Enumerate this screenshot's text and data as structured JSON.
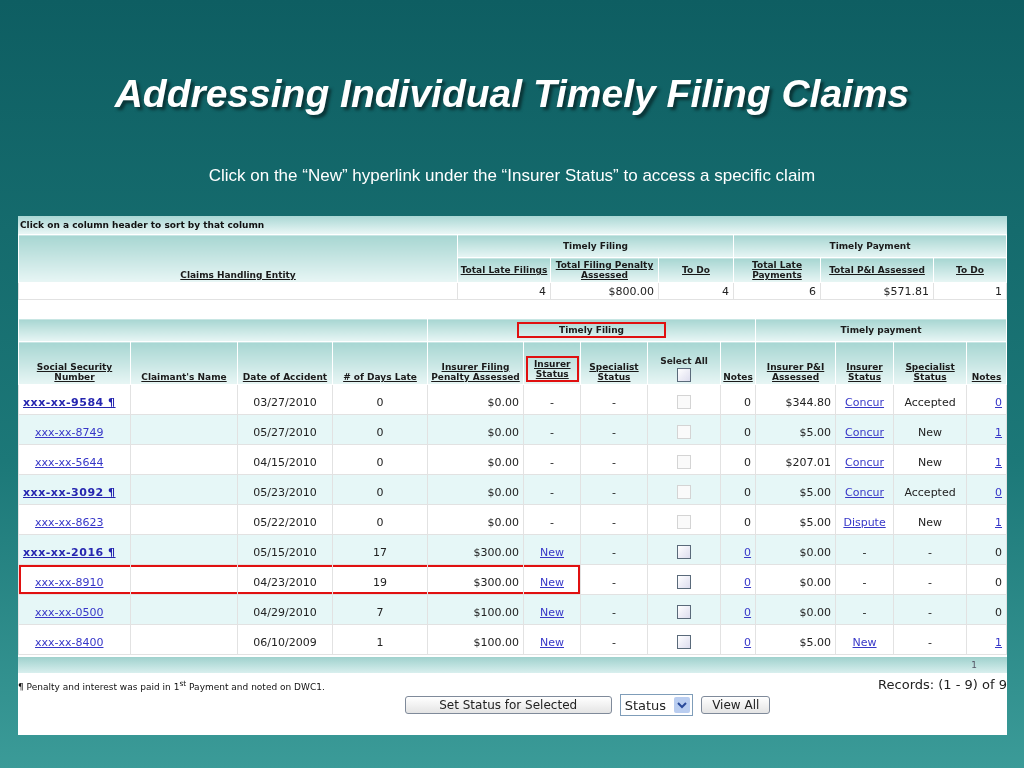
{
  "slide": {
    "title": "Addressing Individual Timely Filing Claims",
    "subtitle": "Click on the “New” hyperlink under the “Insurer Status” to access a specific claim"
  },
  "hint": "Click on a column header to sort by that column",
  "summary": {
    "entity_header": "Claims Handling Entity",
    "groups": [
      {
        "label": "Timely Filing"
      },
      {
        "label": "Timely Payment"
      }
    ],
    "columns": [
      "Total Late Filings",
      "Total Filing Penalty Assessed",
      "To Do",
      "Total Late Payments",
      "Total P&I Assessed",
      "To Do"
    ],
    "values": [
      "4",
      "$800.00",
      "4",
      "6",
      "$571.81",
      "1"
    ]
  },
  "claims": {
    "groups": [
      {
        "label": "Timely Filing",
        "highlighted": true
      },
      {
        "label": "Timely payment",
        "highlighted": false
      }
    ],
    "columns": [
      {
        "label": "Social Security Number",
        "kind": "sort",
        "highlighted": false
      },
      {
        "label": "Claimant's Name",
        "kind": "sort",
        "highlighted": false
      },
      {
        "label": "Date of Accident",
        "kind": "sort",
        "highlighted": false
      },
      {
        "label": "# of Days Late",
        "kind": "sort",
        "highlighted": false
      },
      {
        "label": "Insurer Filing Penalty Assessed",
        "kind": "sort",
        "highlighted": false
      },
      {
        "label": "Insurer Status",
        "kind": "sort",
        "highlighted": true
      },
      {
        "label": "Specialist Status",
        "kind": "sort",
        "highlighted": false
      },
      {
        "label": "Select All",
        "kind": "select_all",
        "highlighted": false,
        "checked": false
      },
      {
        "label": "Notes",
        "kind": "sort",
        "highlighted": false
      },
      {
        "label": "Insurer P&I Assessed",
        "kind": "sort",
        "highlighted": false
      },
      {
        "label": "Insurer Status",
        "kind": "sort",
        "highlighted": false
      },
      {
        "label": "Specialist Status",
        "kind": "sort",
        "highlighted": false
      },
      {
        "label": "Notes",
        "kind": "sort",
        "highlighted": false
      }
    ],
    "rows": [
      {
        "ssn": "xxx-xx-9584 ¶",
        "bold": true,
        "date": "03/27/2010",
        "days": "0",
        "penalty": "$0.00",
        "insurer_status": {
          "text": "-",
          "link": false
        },
        "specialist_status": "-",
        "selectable": false,
        "checked": false,
        "notes": {
          "text": "0",
          "link": false
        },
        "pi": "$344.80",
        "insurer_status_2": {
          "text": "Concur",
          "link": true
        },
        "specialist_status_2": "Accepted",
        "notes_2": {
          "text": "0",
          "link": true
        },
        "highlighted": false
      },
      {
        "ssn": "xxx-xx-8749",
        "bold": false,
        "date": "05/27/2010",
        "days": "0",
        "penalty": "$0.00",
        "insurer_status": {
          "text": "-",
          "link": false
        },
        "specialist_status": "-",
        "selectable": false,
        "checked": false,
        "notes": {
          "text": "0",
          "link": false
        },
        "pi": "$5.00",
        "insurer_status_2": {
          "text": "Concur",
          "link": true
        },
        "specialist_status_2": "New",
        "notes_2": {
          "text": "1",
          "link": true
        },
        "highlighted": false
      },
      {
        "ssn": "xxx-xx-5644",
        "bold": false,
        "date": "04/15/2010",
        "days": "0",
        "penalty": "$0.00",
        "insurer_status": {
          "text": "-",
          "link": false
        },
        "specialist_status": "-",
        "selectable": false,
        "checked": false,
        "notes": {
          "text": "0",
          "link": false
        },
        "pi": "$207.01",
        "insurer_status_2": {
          "text": "Concur",
          "link": true
        },
        "specialist_status_2": "New",
        "notes_2": {
          "text": "1",
          "link": true
        },
        "highlighted": false
      },
      {
        "ssn": "xxx-xx-3092 ¶",
        "bold": true,
        "date": "05/23/2010",
        "days": "0",
        "penalty": "$0.00",
        "insurer_status": {
          "text": "-",
          "link": false
        },
        "specialist_status": "-",
        "selectable": false,
        "checked": false,
        "notes": {
          "text": "0",
          "link": false
        },
        "pi": "$5.00",
        "insurer_status_2": {
          "text": "Concur",
          "link": true
        },
        "specialist_status_2": "Accepted",
        "notes_2": {
          "text": "0",
          "link": true
        },
        "highlighted": false
      },
      {
        "ssn": "xxx-xx-8623",
        "bold": false,
        "date": "05/22/2010",
        "days": "0",
        "penalty": "$0.00",
        "insurer_status": {
          "text": "-",
          "link": false
        },
        "specialist_status": "-",
        "selectable": false,
        "checked": false,
        "notes": {
          "text": "0",
          "link": false
        },
        "pi": "$5.00",
        "insurer_status_2": {
          "text": "Dispute",
          "link": true
        },
        "specialist_status_2": "New",
        "notes_2": {
          "text": "1",
          "link": true
        },
        "highlighted": false
      },
      {
        "ssn": "xxx-xx-2016 ¶",
        "bold": true,
        "date": "05/15/2010",
        "days": "17",
        "penalty": "$300.00",
        "insurer_status": {
          "text": "New",
          "link": true
        },
        "specialist_status": "-",
        "selectable": true,
        "checked": false,
        "notes": {
          "text": "0",
          "link": true
        },
        "pi": "$0.00",
        "insurer_status_2": {
          "text": "-",
          "link": false
        },
        "specialist_status_2": "-",
        "notes_2": {
          "text": "0",
          "link": false
        },
        "highlighted": false
      },
      {
        "ssn": "xxx-xx-8910",
        "bold": false,
        "date": "04/23/2010",
        "days": "19",
        "penalty": "$300.00",
        "insurer_status": {
          "text": "New",
          "link": true
        },
        "specialist_status": "-",
        "selectable": true,
        "checked": false,
        "notes": {
          "text": "0",
          "link": true
        },
        "pi": "$0.00",
        "insurer_status_2": {
          "text": "-",
          "link": false
        },
        "specialist_status_2": "-",
        "notes_2": {
          "text": "0",
          "link": false
        },
        "highlighted": true
      },
      {
        "ssn": "xxx-xx-0500",
        "bold": false,
        "date": "04/29/2010",
        "days": "7",
        "penalty": "$100.00",
        "insurer_status": {
          "text": "New",
          "link": true
        },
        "specialist_status": "-",
        "selectable": true,
        "checked": false,
        "notes": {
          "text": "0",
          "link": true
        },
        "pi": "$0.00",
        "insurer_status_2": {
          "text": "-",
          "link": false
        },
        "specialist_status_2": "-",
        "notes_2": {
          "text": "0",
          "link": false
        },
        "highlighted": false
      },
      {
        "ssn": "xxx-xx-8400",
        "bold": false,
        "date": "06/10/2009",
        "days": "1",
        "penalty": "$100.00",
        "insurer_status": {
          "text": "New",
          "link": true
        },
        "specialist_status": "-",
        "selectable": true,
        "checked": false,
        "notes": {
          "text": "0",
          "link": true
        },
        "pi": "$5.00",
        "insurer_status_2": {
          "text": "New",
          "link": true
        },
        "specialist_status_2": "-",
        "notes_2": {
          "text": "1",
          "link": true
        },
        "highlighted": false
      }
    ]
  },
  "pager": {
    "page": "1"
  },
  "footnote": "¶ Penalty and interest was paid in 1$^{st}$ Payment and noted on DWC1.",
  "records": "Records: (1 - 9) of 9",
  "actions": {
    "set_status": "Set Status for Selected",
    "status_select": "Status",
    "view_all": "View All"
  }
}
